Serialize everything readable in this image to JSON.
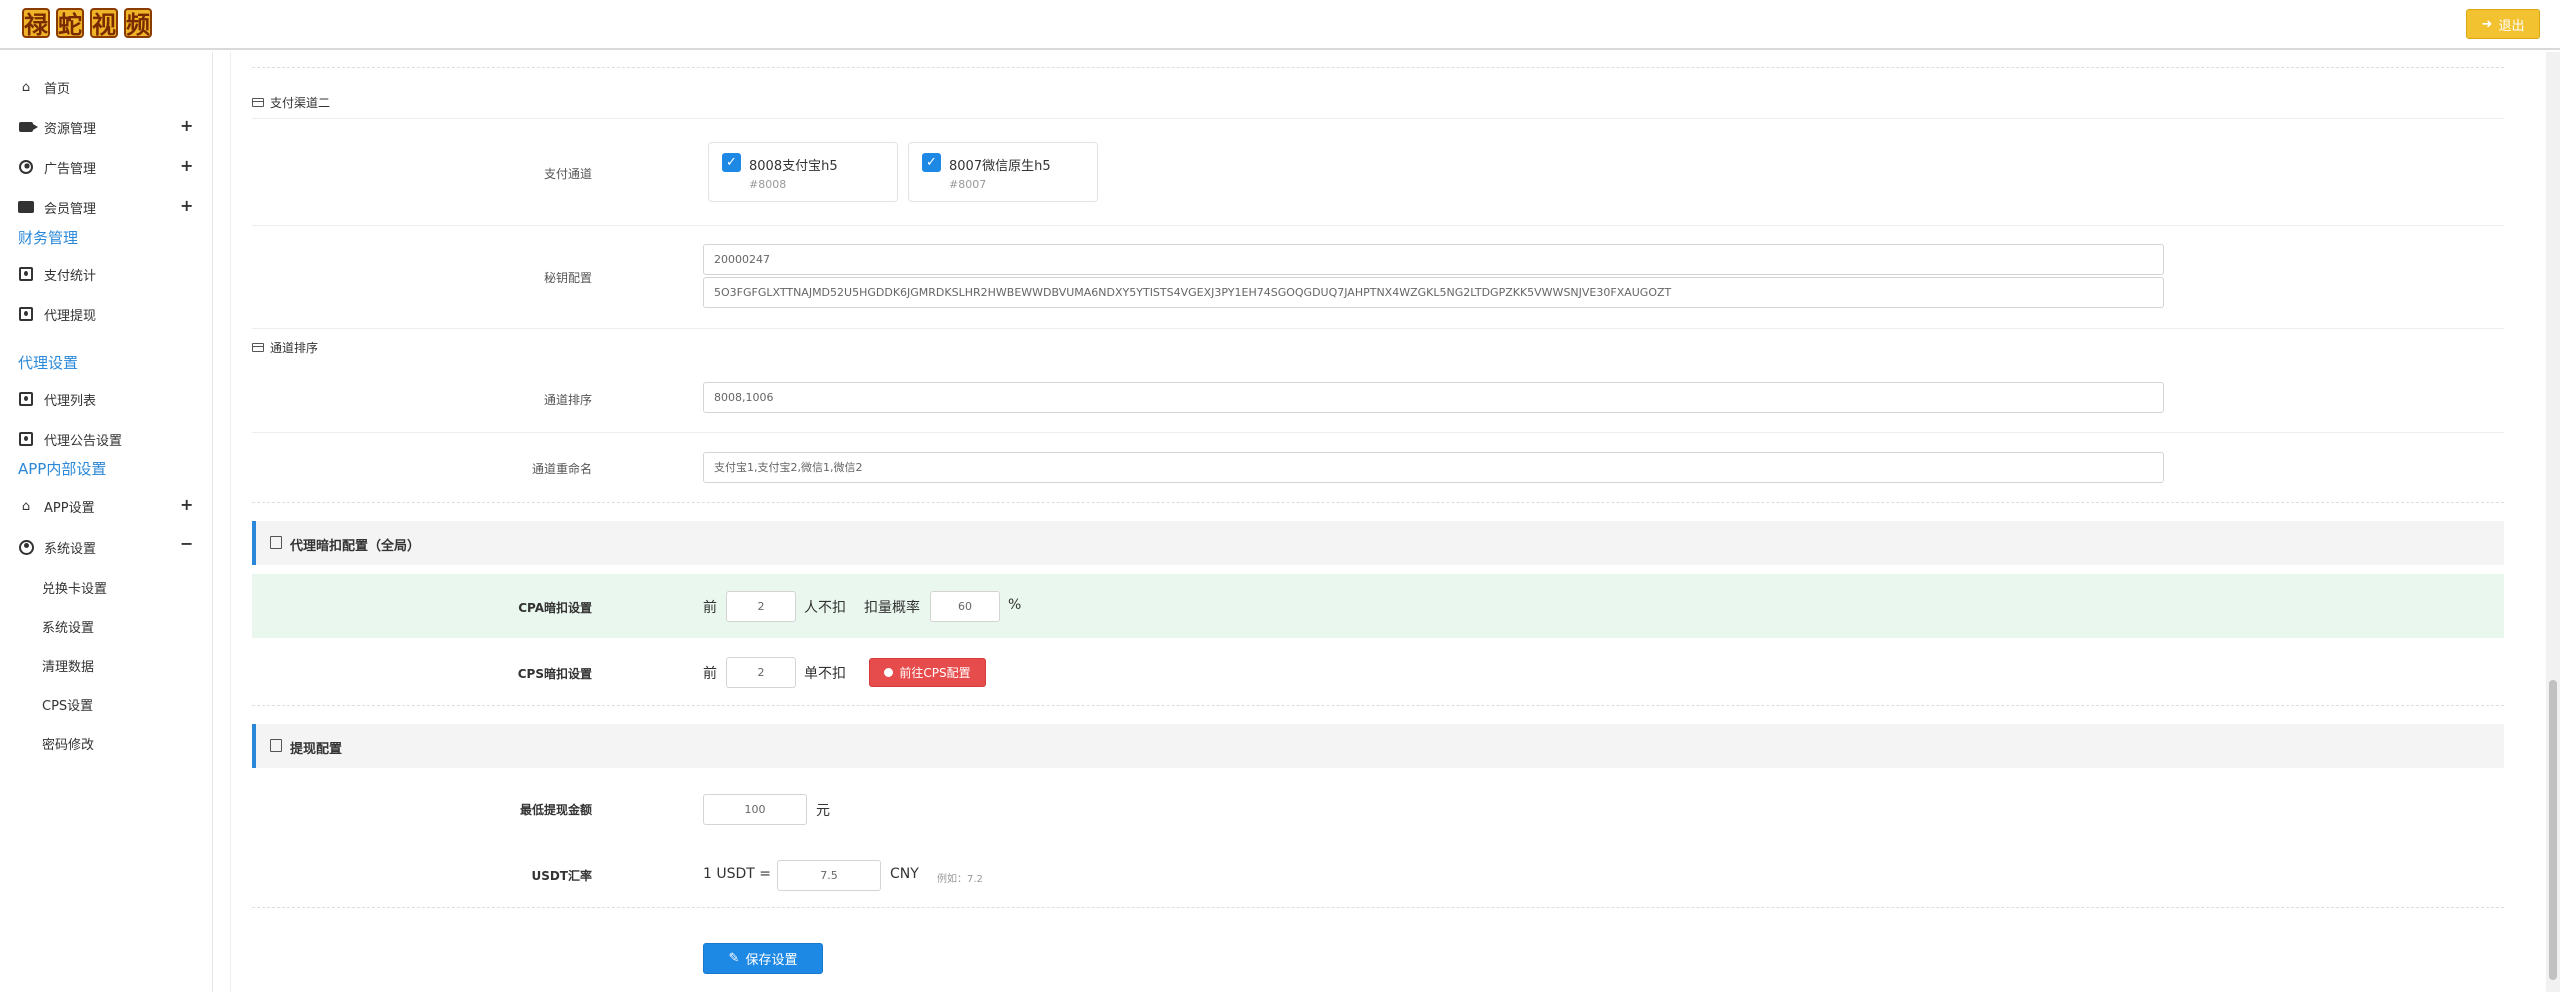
{
  "header": {
    "logo_chars": [
      "禄",
      "蛇",
      "视",
      "频"
    ],
    "logout_label": "退出"
  },
  "sidebar": {
    "items": [
      {
        "label": "首页"
      },
      {
        "label": "资源管理"
      },
      {
        "label": "广告管理"
      },
      {
        "label": "会员管理"
      }
    ],
    "finance_section": "财务管理",
    "finance_items": [
      "支付统计",
      "代理提现"
    ],
    "agent_section": "代理设置",
    "agent_items": [
      "代理列表",
      "代理公告设置"
    ],
    "app_section": "APP内部设置",
    "app_item": "APP设置",
    "system_item": "系统设置",
    "system_subitems": [
      "兑换卡设置",
      "系统设置",
      "清理数据",
      "CPS设置",
      "密码修改"
    ]
  },
  "channel2": {
    "heading": "支付渠道二",
    "channel_label": "支付通道",
    "cards": [
      {
        "name": "8008支付宝h5",
        "code": "#8008",
        "checked": true
      },
      {
        "name": "8007微信原生h5",
        "code": "#8007",
        "checked": true
      }
    ],
    "secret_label": "秘钥配置",
    "secret_id": "20000247",
    "secret_key": "5O3FGFGLXTTNAJMD52U5HGDDK6JGMRDKSLHR2HWBEWWDBVUMA6NDXY5YTISTS4VGEXJ3PY1EH74SGOQGDUQ7JAHPTNX4WZGKL5NG2LTDGPZKK5VWWSNJVE30FXAUGOZT"
  },
  "sorting": {
    "heading": "通道排序",
    "order_label": "通道排序",
    "order_value": "8008,1006",
    "rename_label": "通道重命名",
    "rename_value": "支付宝1,支付宝2,微信1,微信2"
  },
  "deduct": {
    "title": "代理暗扣配置（全局）",
    "cpa_label": "CPA暗扣设置",
    "cpa_prefix": "前",
    "cpa_count": "2",
    "cpa_middle": "人不扣",
    "cpa_rate_label": "扣量概率",
    "cpa_rate": "60",
    "cpa_unit": "%",
    "cps_label": "CPS暗扣设置",
    "cps_prefix": "前",
    "cps_count": "2",
    "cps_middle": "单不扣",
    "cps_button": "前往CPS配置"
  },
  "withdraw": {
    "title": "提现配置",
    "min_label": "最低提现金额",
    "min_value": "100",
    "min_unit": "元",
    "usdt_label": "USDT汇率",
    "usdt_prefix": "1 USDT =",
    "usdt_value": "7.5",
    "usdt_unit": "CNY",
    "usdt_hint": "例如：7.2"
  },
  "save_label": "保存设置",
  "colors": {
    "accent": "#2b88d8",
    "primary_button": "#1e88e5",
    "danger_button": "#e74c4c",
    "logout_button": "#f2c230",
    "highlight_row": "#eaf7ee"
  }
}
